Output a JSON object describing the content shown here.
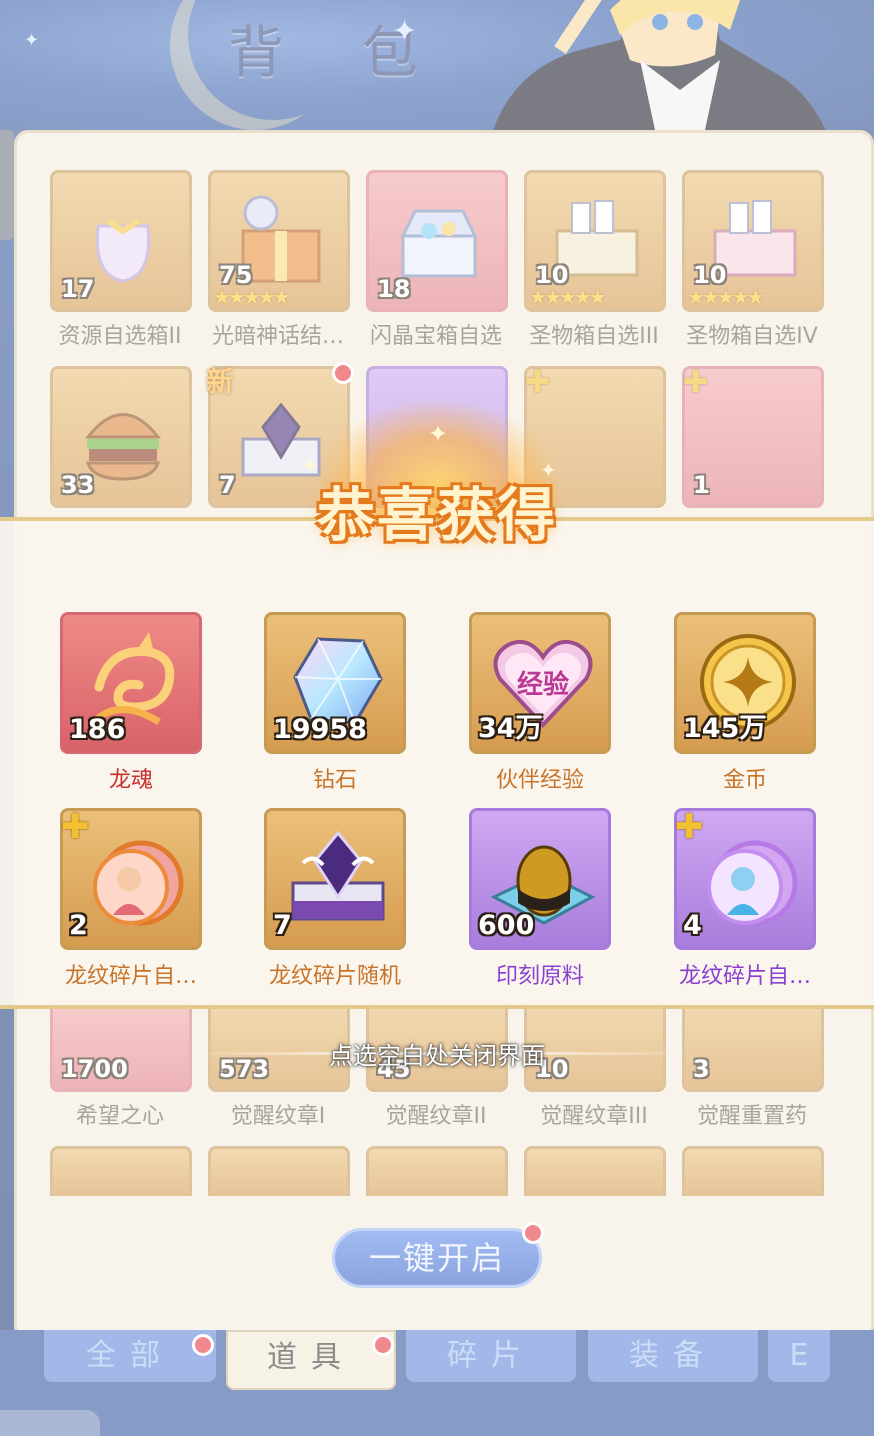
{
  "page": {
    "title": "背 包"
  },
  "inventory": {
    "row1": [
      {
        "name": "资源自选箱II",
        "count": "17"
      },
      {
        "name": "光暗神话结…",
        "count": "75"
      },
      {
        "name": "闪晶宝箱自选",
        "count": "18"
      },
      {
        "name": "圣物箱自选III",
        "count": "10"
      },
      {
        "name": "圣物箱自选IV",
        "count": "10"
      }
    ],
    "row2": [
      {
        "count": "33"
      },
      {
        "count": "7",
        "tag": "新"
      },
      {
        "count": ""
      },
      {
        "count": ""
      },
      {
        "count": "1"
      }
    ],
    "row5": [
      {
        "name": "希望之心",
        "count": "1700"
      },
      {
        "name": "觉醒纹章I",
        "count": "573"
      },
      {
        "name": "觉醒纹章II",
        "count": "45"
      },
      {
        "name": "觉醒纹章III",
        "count": "10"
      },
      {
        "name": "觉醒重置药",
        "count": "3"
      }
    ]
  },
  "reward": {
    "title": "恭喜获得",
    "items": [
      {
        "name": "龙魂",
        "count": "186",
        "name_color": "#c8302c",
        "icon": "dragon-icon"
      },
      {
        "name": "钻石",
        "count": "19958",
        "name_color": "#c8742a",
        "icon": "diamond-icon"
      },
      {
        "name": "伙伴经验",
        "count": "34万",
        "name_color": "#c8742a",
        "icon": "exp-heart-icon",
        "icon_text": "经验"
      },
      {
        "name": "金币",
        "count": "145万",
        "name_color": "#c8742a",
        "icon": "gold-coin-icon"
      },
      {
        "name": "龙纹碎片自…",
        "count": "2",
        "name_color": "#c8742a",
        "icon": "fragment-icon"
      },
      {
        "name": "龙纹碎片随机",
        "count": "7",
        "name_color": "#c8742a",
        "icon": "chest-icon"
      },
      {
        "name": "印刻原料",
        "count": "600",
        "name_color": "#8b3fd1",
        "icon": "egg-icon"
      },
      {
        "name": "龙纹碎片自…",
        "count": "4",
        "name_color": "#8b3fd1",
        "icon": "fragment-icon"
      }
    ],
    "close_hint": "点选空白处关闭界面"
  },
  "actions": {
    "open_all": "一键开启"
  },
  "tabs": [
    {
      "label": "全部"
    },
    {
      "label": "道具"
    },
    {
      "label": "碎片"
    },
    {
      "label": "装备"
    },
    {
      "label": "E"
    }
  ],
  "colors": {
    "accent": "#e47a1e",
    "tab_blue": "#5d86d9",
    "panel": "#f3ecdc"
  }
}
